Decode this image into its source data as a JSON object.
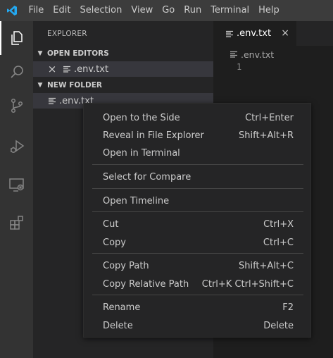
{
  "app": {
    "logo_icon": "vscode-logo-icon",
    "accent_color": "#007acc"
  },
  "menubar": {
    "items": [
      "File",
      "Edit",
      "Selection",
      "View",
      "Go",
      "Run",
      "Terminal",
      "Help"
    ]
  },
  "activitybar": {
    "icons": [
      "explorer-icon",
      "search-icon",
      "source-control-icon",
      "run-debug-icon",
      "remote-explorer-icon",
      "extensions-icon"
    ]
  },
  "sidebar": {
    "title": "EXPLORER",
    "open_editors": {
      "header": "OPEN EDITORS",
      "items": [
        {
          "close_glyph": "×",
          "name": ".env.txt"
        }
      ]
    },
    "folder": {
      "header": "NEW FOLDER",
      "items": [
        {
          "name": ".env.txt"
        }
      ]
    }
  },
  "editor": {
    "tab": {
      "label": ".env.txt",
      "close_glyph": "×"
    },
    "breadcrumb": ".env.txt",
    "line_numbers": [
      "1"
    ]
  },
  "context_menu": {
    "groups": [
      [
        {
          "label": "Open to the Side",
          "shortcut": "Ctrl+Enter"
        },
        {
          "label": "Reveal in File Explorer",
          "shortcut": "Shift+Alt+R"
        },
        {
          "label": "Open in Terminal",
          "shortcut": ""
        }
      ],
      [
        {
          "label": "Select for Compare",
          "shortcut": ""
        }
      ],
      [
        {
          "label": "Open Timeline",
          "shortcut": ""
        }
      ],
      [
        {
          "label": "Cut",
          "shortcut": "Ctrl+X"
        },
        {
          "label": "Copy",
          "shortcut": "Ctrl+C"
        }
      ],
      [
        {
          "label": "Copy Path",
          "shortcut": "Shift+Alt+C"
        },
        {
          "label": "Copy Relative Path",
          "shortcut": "Ctrl+K Ctrl+Shift+C"
        }
      ],
      [
        {
          "label": "Rename",
          "shortcut": "F2"
        },
        {
          "label": "Delete",
          "shortcut": "Delete"
        }
      ]
    ]
  }
}
